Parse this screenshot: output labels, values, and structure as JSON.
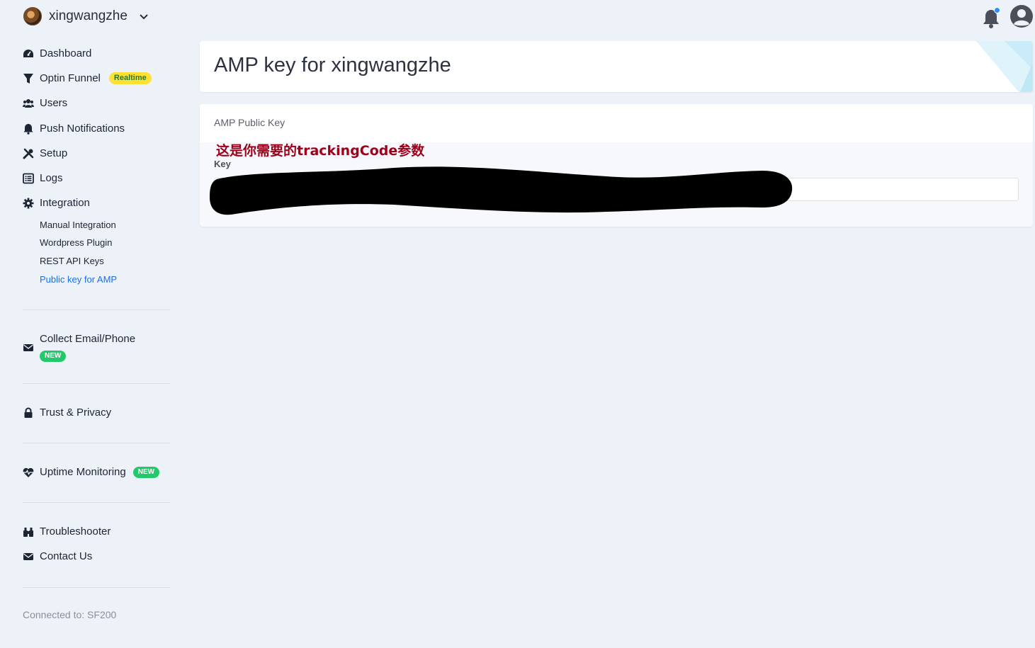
{
  "account": {
    "name": "xingwangzhe"
  },
  "sidebar": {
    "items": [
      {
        "label": "Dashboard",
        "icon": "dashboard-icon"
      },
      {
        "label": "Optin Funnel",
        "icon": "funnel-icon",
        "badge": "Realtime"
      },
      {
        "label": "Users",
        "icon": "users-icon"
      },
      {
        "label": "Push Notifications",
        "icon": "bell-icon"
      },
      {
        "label": "Setup",
        "icon": "tools-icon"
      },
      {
        "label": "Logs",
        "icon": "list-icon"
      },
      {
        "label": "Integration",
        "icon": "gear-icon"
      }
    ],
    "integration_sub": [
      {
        "label": "Manual Integration"
      },
      {
        "label": "Wordpress Plugin"
      },
      {
        "label": "REST API Keys"
      },
      {
        "label": "Public key for AMP",
        "active": true
      }
    ],
    "collect": {
      "label": "Collect Email/Phone",
      "badge": "NEW",
      "icon": "envelope-icon"
    },
    "trust": {
      "label": "Trust & Privacy",
      "icon": "lock-icon"
    },
    "uptime": {
      "label": "Uptime Monitoring",
      "badge": "NEW",
      "icon": "heartbeat-icon"
    },
    "troubleshooter": {
      "label": "Troubleshooter",
      "icon": "binoculars-icon"
    },
    "contact": {
      "label": "Contact Us",
      "icon": "envelope-icon"
    },
    "connected": "Connected to: SF200"
  },
  "header": {
    "notifications_icon": "bell-icon",
    "profile_icon": "user-circle-icon"
  },
  "main": {
    "title": "AMP key for xingwangzhe",
    "card_title": "AMP Public Key",
    "annotation": "这是你需要的trackingCode参数",
    "key_label": "Key",
    "key_value": ""
  },
  "colors": {
    "accent": "#1f6fe5",
    "badge_realtime": "#ffe135",
    "badge_new": "#22c96a",
    "annotation": "#9e0019",
    "background": "#edf1f8"
  }
}
